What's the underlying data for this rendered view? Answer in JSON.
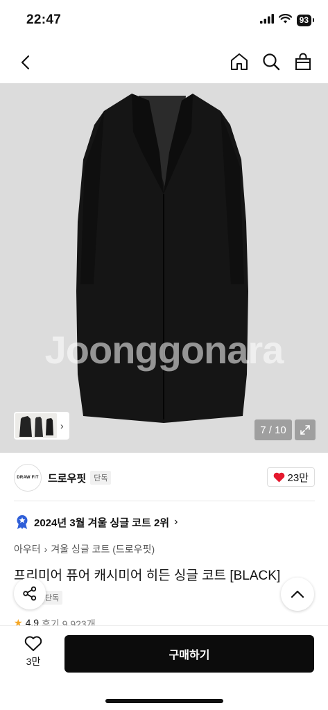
{
  "status": {
    "time": "22:47",
    "battery": "93"
  },
  "hero": {
    "watermark": "Joonggonara",
    "counter": "7 / 10"
  },
  "seller": {
    "name": "드로우핏",
    "logo_text": "DRAW FIT",
    "badge": "단독",
    "likes": "23만"
  },
  "ranking": {
    "text": "2024년 3월 겨울 싱글 코트 2위"
  },
  "category": {
    "level1": "아우터",
    "level2": "겨울 싱글 코트 (드로우핏)"
  },
  "product": {
    "title": "프리미어 퓨어 캐시미어 히든 싱글 코트 [BLACK]",
    "badge": "단독",
    "rating": "4.9",
    "reviews": "후기 9,923개"
  },
  "bottom": {
    "wish_count": "3만",
    "buy_label": "구매하기"
  },
  "colors": {
    "like": "#e5192e",
    "ranking_badge": "#2f5fd8",
    "buy_bg": "#0c0c0c"
  }
}
